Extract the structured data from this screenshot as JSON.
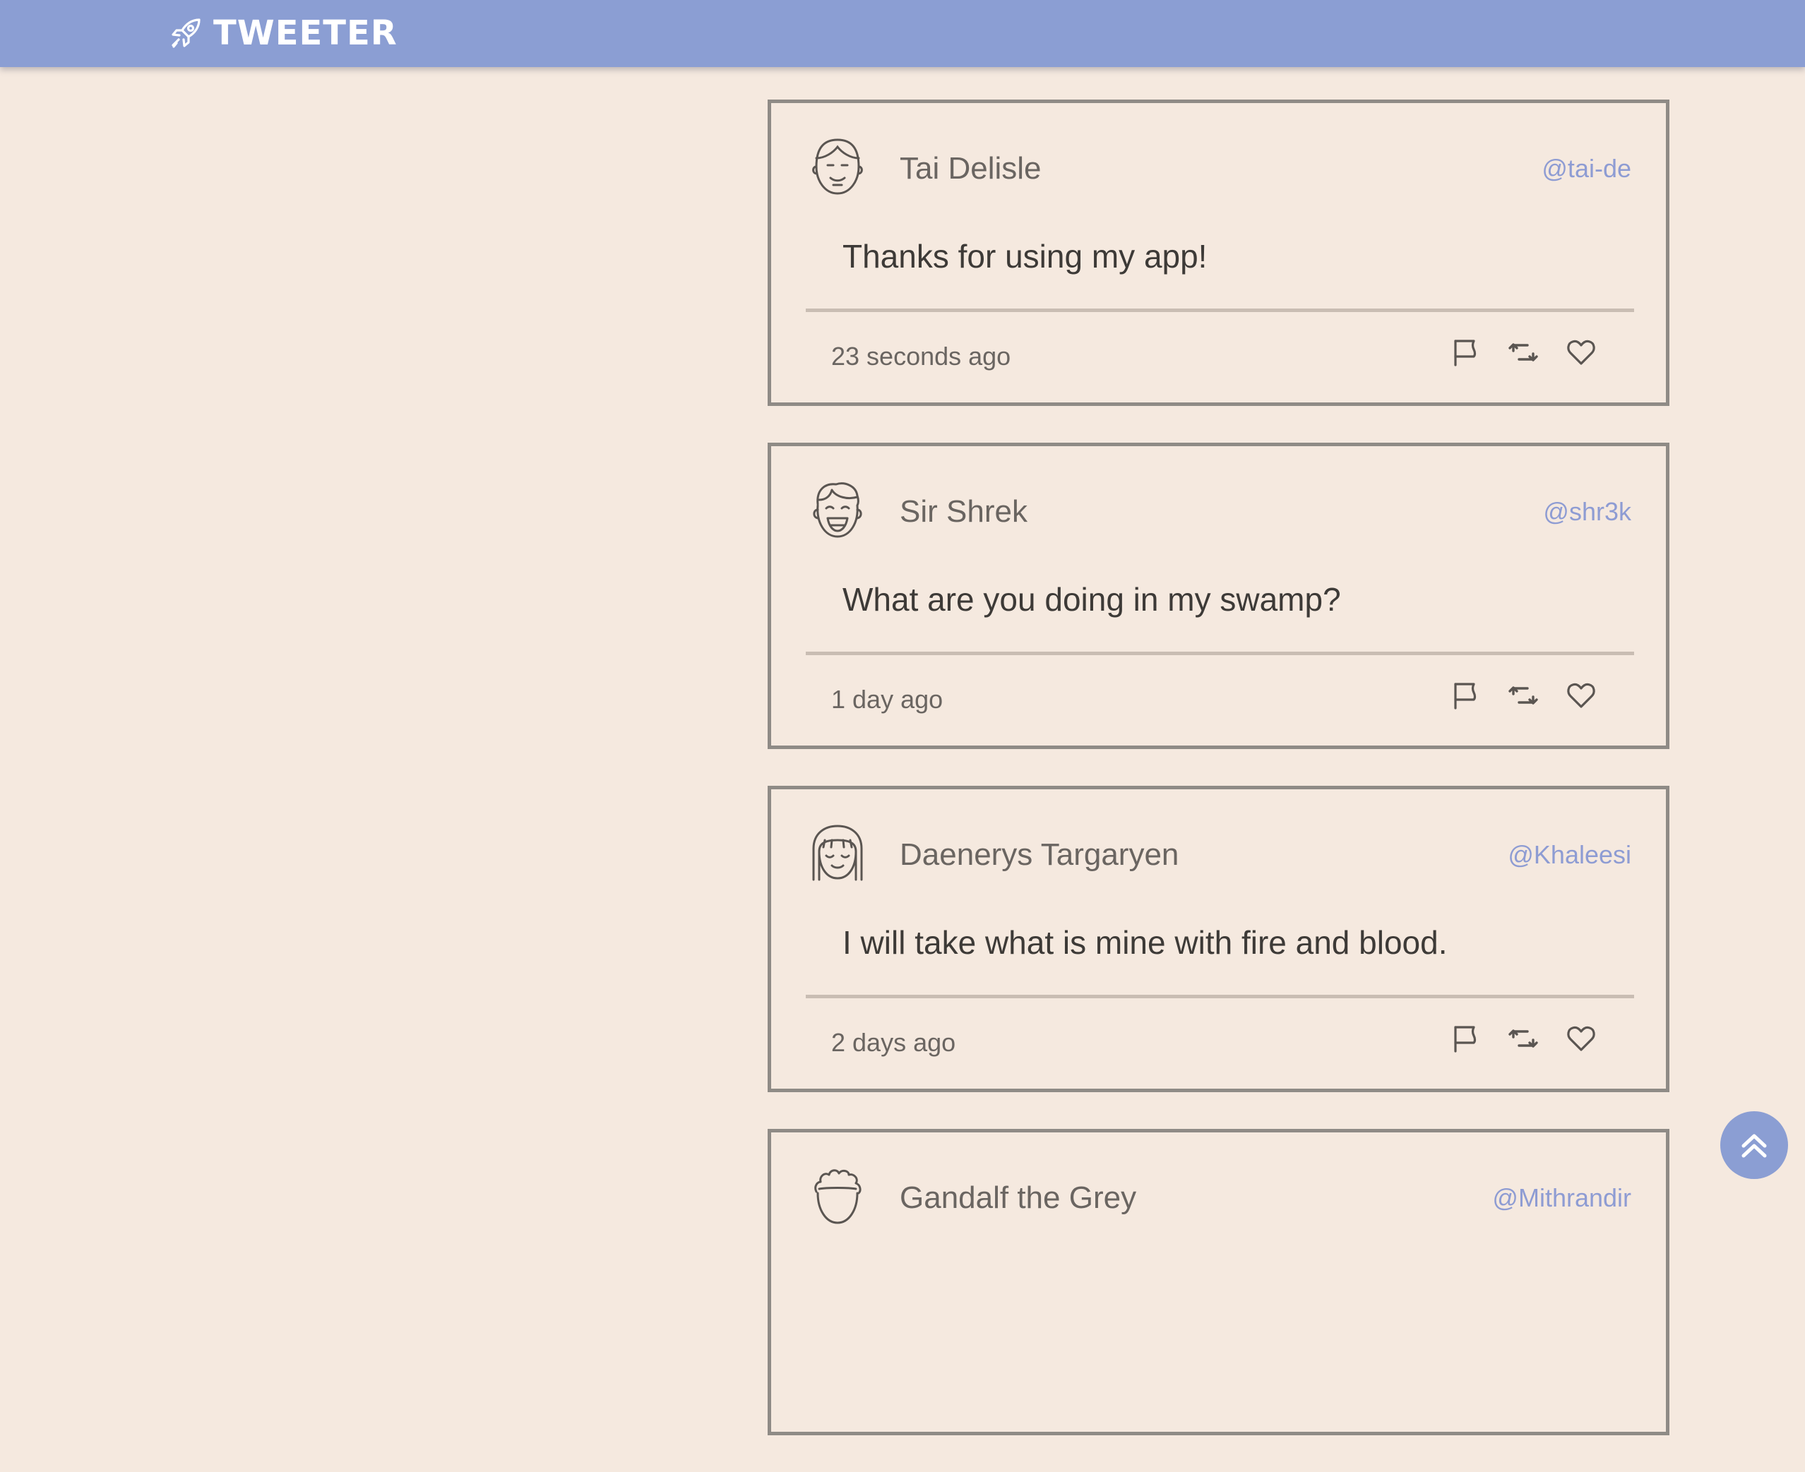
{
  "nav": {
    "brand_title": "TWEETER",
    "brand_icon": "rocket-icon",
    "background": "#8b9ed3"
  },
  "colors": {
    "page_background": "#f5e9df",
    "handle_color": "#8e9cd3",
    "border_color": "#8f8b86"
  },
  "tweets": [
    {
      "name": "Tai Delisle",
      "handle": "@tai-de",
      "content": "Thanks for using my app!",
      "time": "23 seconds ago",
      "avatar_icon": "smiling-man-avatar"
    },
    {
      "name": "Sir Shrek",
      "handle": "@shr3k",
      "content": "What are you doing in my swamp?",
      "time": "1 day ago",
      "avatar_icon": "laughing-man-avatar"
    },
    {
      "name": "Daenerys Targaryen",
      "handle": "@Khaleesi",
      "content": "I will take what is mine with fire and blood.",
      "time": "2 days ago",
      "avatar_icon": "woman-bangs-avatar"
    },
    {
      "name": "Gandalf the Grey",
      "handle": "@Mithrandir",
      "content": "",
      "time": "",
      "avatar_icon": "curly-hair-avatar"
    }
  ],
  "actions": [
    "flag-icon",
    "retweet-icon",
    "heart-icon"
  ],
  "back_to_top_icon": "double-chevron-up-icon"
}
